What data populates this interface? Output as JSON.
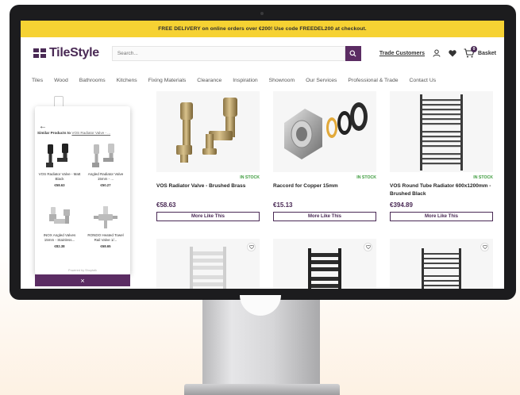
{
  "promo": {
    "text": "FREE DELIVERY on online orders over €200! Use code FREEDEL200 at checkout."
  },
  "header": {
    "logo": "TileStyle",
    "search_placeholder": "Search...",
    "trade_link": "Trade Customers",
    "basket_label": "Basket",
    "basket_count": "0"
  },
  "nav": {
    "items": [
      "Tiles",
      "Wood",
      "Bathrooms",
      "Kitchens",
      "Fixing Materials",
      "Clearance",
      "Inspiration",
      "Showroom",
      "Our Services",
      "Professional & Trade",
      "Contact Us"
    ]
  },
  "products": [
    {
      "stock": "IN STOCK",
      "name": "VOS Radiator Valve - Brushed Brass",
      "price": "€58.63",
      "button": "More Like This"
    },
    {
      "stock": "IN STOCK",
      "name": "Raccord for Copper 15mm",
      "price": "€15.13",
      "button": "More Like This"
    },
    {
      "stock": "IN STOCK",
      "name": "VOS Round Tube Radiator 600x1200mm - Brushed Black",
      "price": "€394.89",
      "button": "More Like This"
    }
  ],
  "similar_panel": {
    "title_prefix": "Similar Products to",
    "title_product": "VOS Radiator Valve - ...",
    "items": [
      {
        "name": "VOS Radiator Valve - Matt Black",
        "price": "€58.63"
      },
      {
        "name": "Angled Radiator Valve 15mm - ...",
        "price": "€50.27"
      },
      {
        "name": "INOX Angled Valves 15mm - Stainless...",
        "price": "€82.38"
      },
      {
        "name": "RONDO Heated Towel Rail Valve 1/...",
        "price": "€68.65"
      }
    ],
    "footer": "Powered by Shoptalk",
    "close_icon": "×"
  },
  "behind_stock": "IN STOCK"
}
